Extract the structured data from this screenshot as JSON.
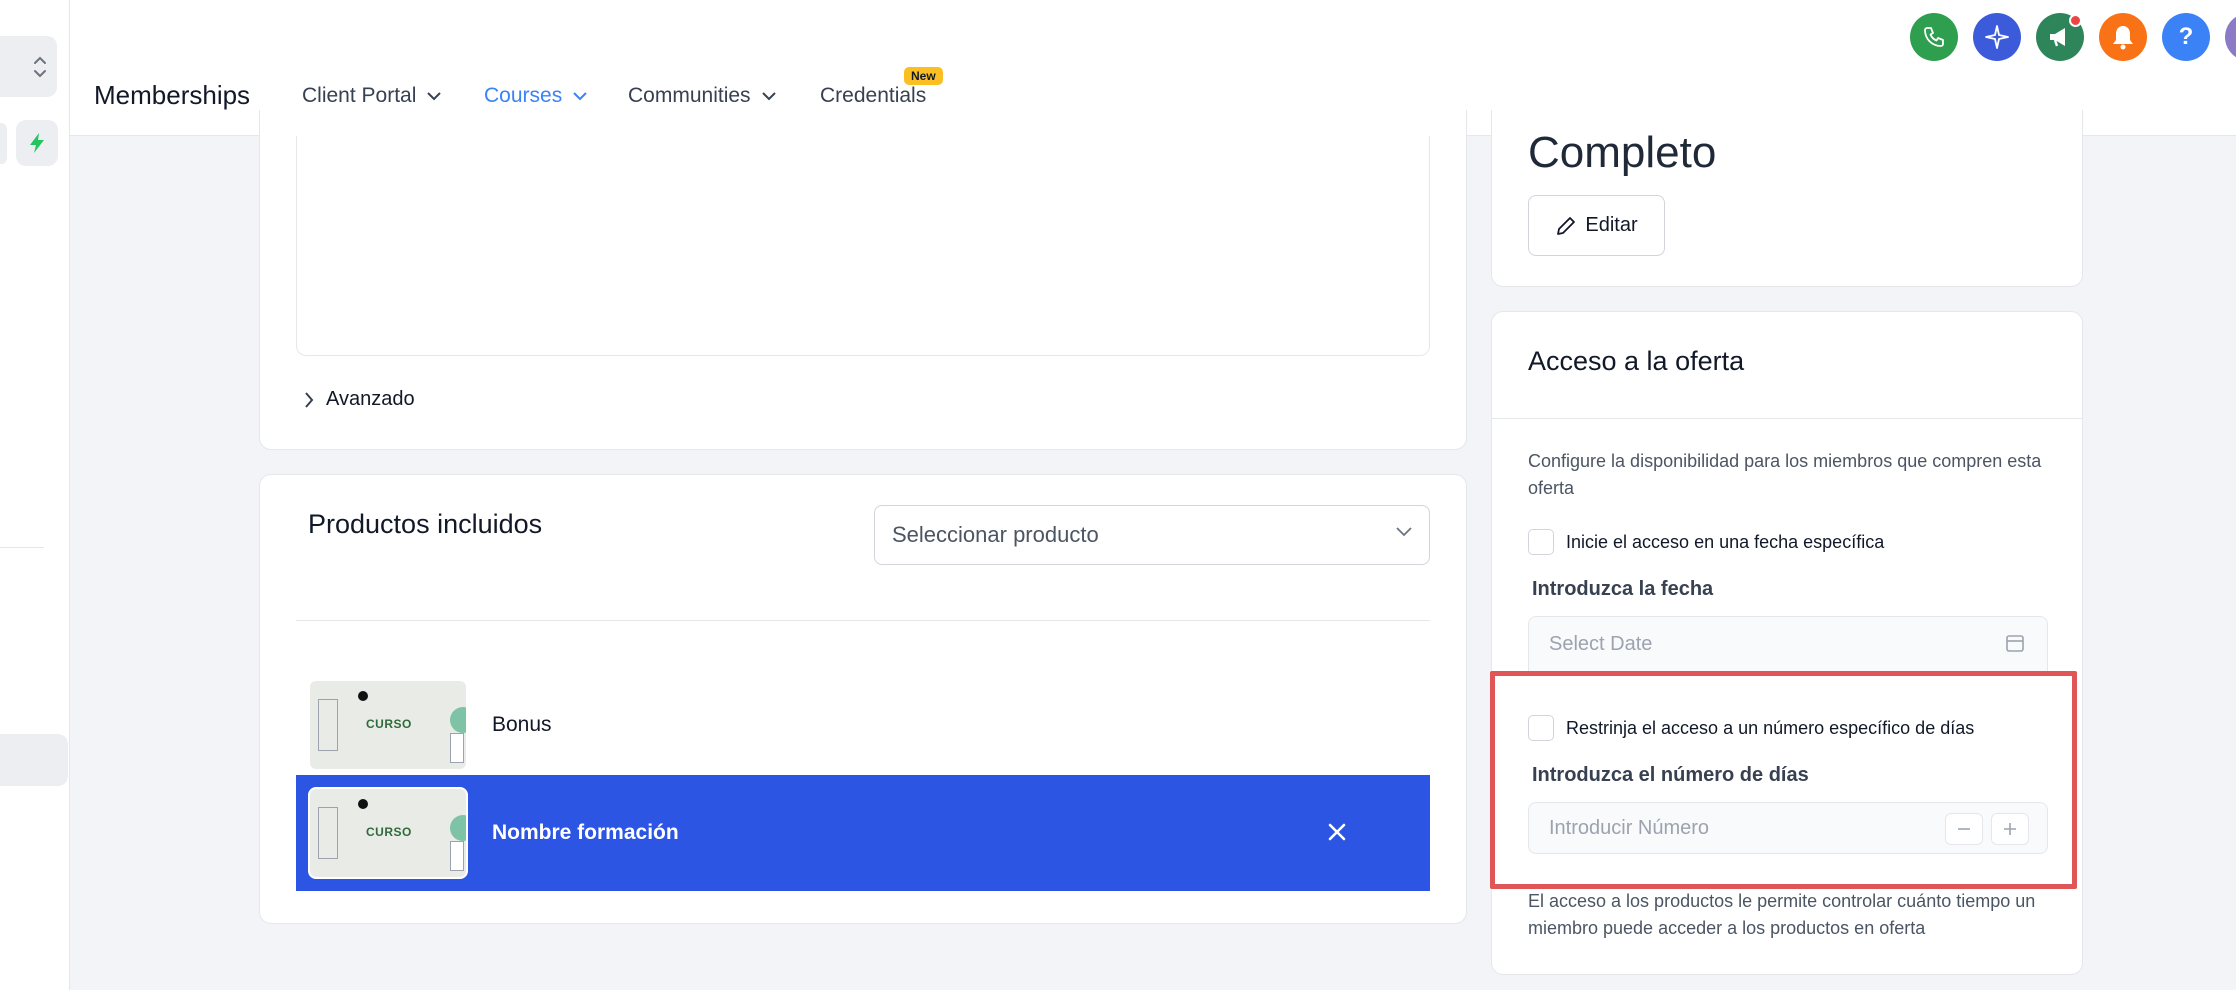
{
  "header": {
    "brand": "Memberships",
    "nav": [
      {
        "label": "Client Portal",
        "has_dropdown": true
      },
      {
        "label": "Courses",
        "has_dropdown": true,
        "active": true
      },
      {
        "label": "Communities",
        "has_dropdown": true
      },
      {
        "label": "Credentials",
        "badge": "New"
      }
    ],
    "actions": [
      {
        "icon": "phone-icon",
        "color": "#2e9e4f"
      },
      {
        "icon": "sparkle-icon",
        "color": "#3b5bdb"
      },
      {
        "icon": "megaphone-icon",
        "color": "#2f855a",
        "has_notification": true
      },
      {
        "icon": "bell-icon",
        "color": "#f97316"
      },
      {
        "icon": "help-icon",
        "color": "#3b82f6",
        "text": "?"
      },
      {
        "icon": "avatar",
        "color": "#8b7bc7"
      }
    ]
  },
  "advanced": {
    "label": "Avanzado"
  },
  "products": {
    "title": "Productos incluidos",
    "select_placeholder": "Seleccionar producto",
    "items": [
      {
        "name": "Bonus",
        "thumb_label": "CURSO",
        "selected": false
      },
      {
        "name": "Nombre formación",
        "thumb_label": "CURSO",
        "selected": true
      }
    ]
  },
  "status": {
    "value": "Completo",
    "edit_label": "Editar"
  },
  "access": {
    "title": "Acceso a la oferta",
    "description": "Configure la disponibilidad para los miembros que compren esta oferta",
    "start_date": {
      "checkbox_label": "Inicie el acceso en una fecha específica",
      "field_label": "Introduzca la fecha",
      "placeholder": "Select Date"
    },
    "days": {
      "checkbox_label": "Restrinja el acceso a un número específico de días",
      "field_label": "Introduzca el número de días",
      "placeholder": "Introducir Número"
    },
    "footer": "El acceso a los productos le permite controlar cuánto tiempo un miembro puede acceder a los productos en oferta"
  },
  "colors": {
    "accent": "#3b82f6",
    "selected_row": "#2c55e4",
    "highlight": "#e05555",
    "badge": "#fbbf24"
  }
}
